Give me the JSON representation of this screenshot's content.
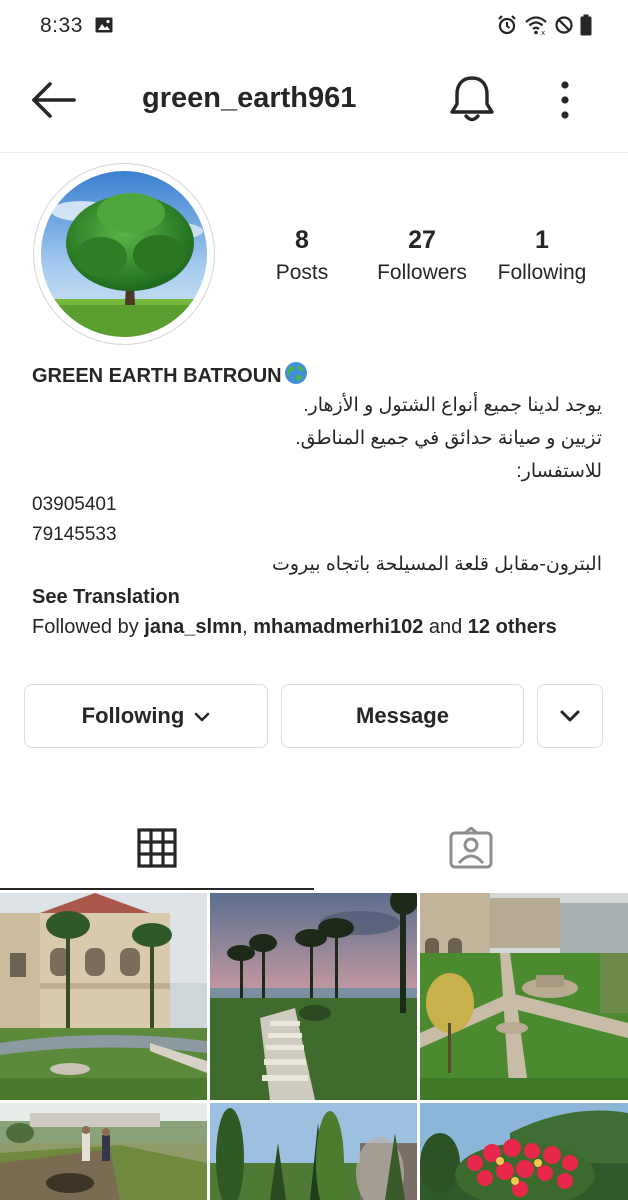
{
  "status_bar": {
    "time": "8:33"
  },
  "header": {
    "username": "green_earth961",
    "back_icon": "arrow-left-icon",
    "bell_icon": "bell-icon",
    "more_icon": "more-vertical-icon"
  },
  "profile": {
    "stats": {
      "posts_count": "8",
      "posts_label": "Posts",
      "followers_count": "27",
      "followers_label": "Followers",
      "following_count": "1",
      "following_label": "Following"
    },
    "bio": {
      "name": "GREEN EARTH BATROUN",
      "name_emoji": "globe-icon",
      "lines": [
        "يوجد لدينا جميع أنواع الشتول  و الأزهار.",
        "تزيين و صيانة حدائق في جميع المناطق.",
        "للاستفسار:",
        "03905401",
        "79145533",
        "البترون-مقابل قلعة المسيلحة باتجاه بيروت"
      ],
      "see_translation": "See Translation",
      "followed_by_prefix": "Followed by ",
      "followed_user_1": "jana_slmn",
      "followed_sep": ", ",
      "followed_user_2": "mhamadmerhi102",
      "followed_and": " and ",
      "followed_others": "12 others"
    }
  },
  "actions": {
    "following_label": "Following",
    "message_label": "Message"
  },
  "tabs": {
    "grid_icon": "grid-icon",
    "tagged_icon": "tagged-person-icon",
    "active": "grid"
  },
  "colors": {
    "text": "#262626",
    "border": "#dbdbdb"
  }
}
